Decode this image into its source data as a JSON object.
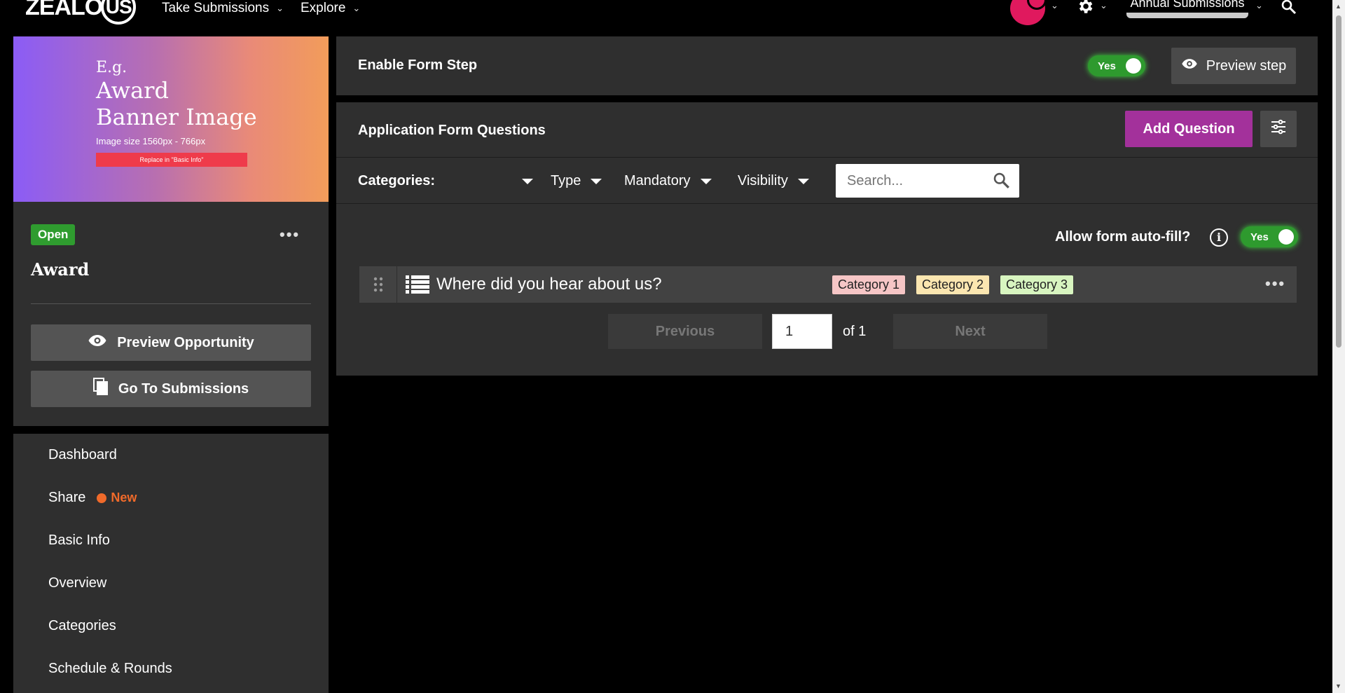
{
  "topbar": {
    "logo_text": "ZEALO",
    "logo_circle": "US",
    "nav": [
      {
        "label": "Take Submissions"
      },
      {
        "label": "Explore"
      }
    ],
    "org_name": "Annual Submissions",
    "chevron": "⌄"
  },
  "banner": {
    "eg": "E.g.",
    "line1": "Award",
    "line2": "Banner Image",
    "size": "Image size 1560px - 766px",
    "replace": "Replace in \"Basic Info\""
  },
  "opportunity": {
    "status": "Open",
    "title": "Award",
    "preview_label": "Preview Opportunity",
    "submissions_label": "Go To Submissions"
  },
  "sidebar": {
    "items": [
      {
        "label": "Dashboard"
      },
      {
        "label": "Share",
        "badge": "New"
      },
      {
        "label": "Basic Info"
      },
      {
        "label": "Overview"
      },
      {
        "label": "Categories"
      },
      {
        "label": "Schedule & Rounds"
      }
    ]
  },
  "form_step": {
    "title": "Enable Form Step",
    "toggle": "Yes",
    "preview_label": "Preview step"
  },
  "questions_panel": {
    "title": "Application Form Questions",
    "add_label": "Add Question",
    "filters": {
      "categories": "Categories:",
      "type": "Type",
      "mandatory": "Mandatory",
      "visibility": "Visibility"
    },
    "search_placeholder": "Search...",
    "autofill_label": "Allow form auto-fill?",
    "autofill_toggle": "Yes",
    "info_glyph": "i",
    "questions": [
      {
        "text": "Where did you hear about us?",
        "categories": [
          {
            "label": "Category 1",
            "color": "#f6c6c6"
          },
          {
            "label": "Category 2",
            "color": "#fbe6b0"
          },
          {
            "label": "Category 3",
            "color": "#d8f5c0"
          }
        ]
      }
    ],
    "pager": {
      "previous": "Previous",
      "page": "1",
      "of": "of 1",
      "next": "Next"
    }
  },
  "colors": {
    "accent_purple": "#a3319b",
    "toggle_green": "#2e9a2e",
    "status_green": "#2f9c2f",
    "new_orange": "#f06a2a",
    "panel_bg": "#2f2f2f"
  }
}
